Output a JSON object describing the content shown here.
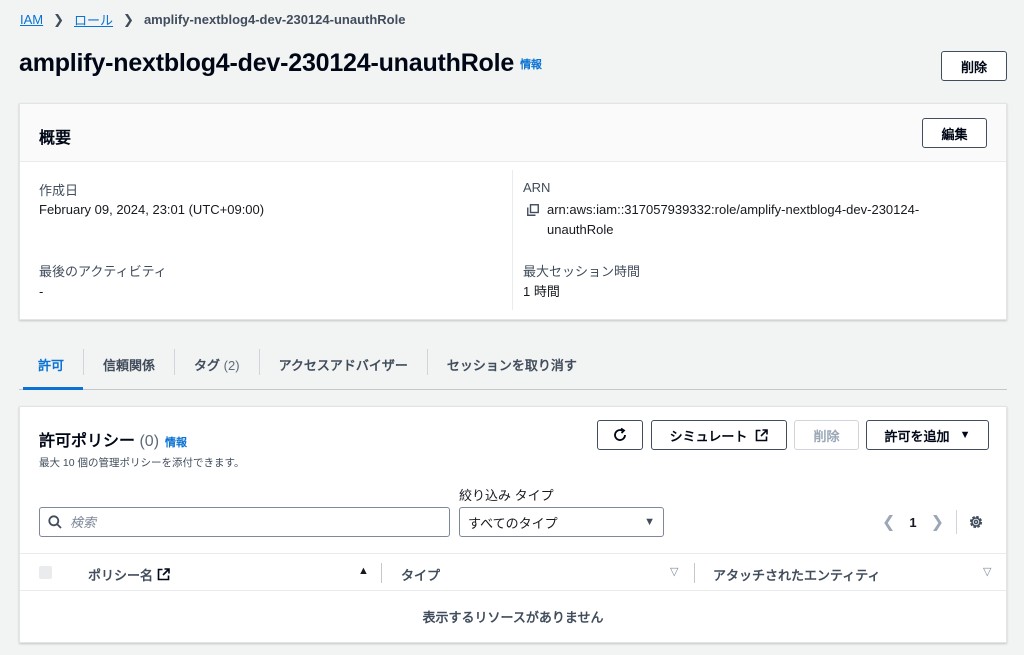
{
  "breadcrumb": {
    "items": [
      "IAM",
      "ロール"
    ],
    "current": "amplify-nextblog4-dev-230124-unauthRole"
  },
  "header": {
    "title": "amplify-nextblog4-dev-230124-unauthRole",
    "info": "情報",
    "delete_label": "削除"
  },
  "summary": {
    "title": "概要",
    "edit_label": "編集",
    "created_label": "作成日",
    "created_value": "February 09, 2024, 23:01 (UTC+09:00)",
    "arn_label": "ARN",
    "arn_line1": "arn:aws:iam::317057939332:role/amplify-nextblog4-dev-230124-",
    "arn_line2": "unauthRole",
    "last_activity_label": "最後のアクティビティ",
    "last_activity_value": "-",
    "max_session_label": "最大セッション時間",
    "max_session_value": "1 時間"
  },
  "tabs": [
    {
      "label": "許可",
      "count": ""
    },
    {
      "label": "信頼関係",
      "count": ""
    },
    {
      "label": "タグ",
      "count": "(2)"
    },
    {
      "label": "アクセスアドバイザー",
      "count": ""
    },
    {
      "label": "セッションを取り消す",
      "count": ""
    }
  ],
  "policies": {
    "title": "許可ポリシー",
    "count": "(0)",
    "info": "情報",
    "description": "最大 10 個の管理ポリシーを添付できます。",
    "simulate_label": "シミュレート",
    "delete_label": "削除",
    "add_label": "許可を追加",
    "filter_label": "絞り込み タイプ",
    "search_placeholder": "検索",
    "type_selected": "すべてのタイプ",
    "page": "1",
    "columns": [
      "ポリシー名",
      "タイプ",
      "アタッチされたエンティティ"
    ],
    "empty_message": "表示するリソースがありません"
  },
  "colors": {
    "link": "#0972d3",
    "text": "#16191f",
    "background": "#f2f3f3"
  }
}
